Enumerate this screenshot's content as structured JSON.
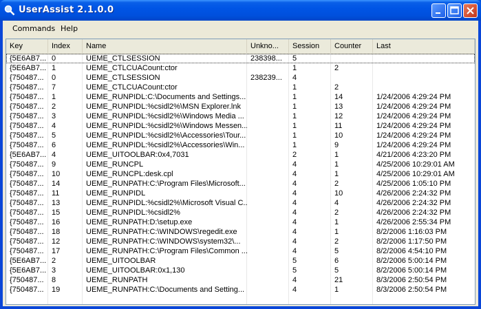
{
  "window": {
    "title": "UserAssist 2.1.0.0"
  },
  "menu": {
    "commands": "Commands",
    "help": "Help"
  },
  "columns": [
    "Key",
    "Index",
    "Name",
    "Unkno...",
    "Session",
    "Counter",
    "Last"
  ],
  "rows": [
    [
      "{5E6AB7...",
      "0",
      "UEME_CTLSESSION",
      "238398...",
      "5",
      "",
      ""
    ],
    [
      "{5E6AB7...",
      "1",
      "UEME_CTLCUACount:ctor",
      "",
      "1",
      "2",
      ""
    ],
    [
      "{750487...",
      "0",
      "UEME_CTLSESSION",
      "238239...",
      "4",
      "",
      ""
    ],
    [
      "{750487...",
      "7",
      "UEME_CTLCUACount:ctor",
      "",
      "1",
      "2",
      ""
    ],
    [
      "{750487...",
      "1",
      "UEME_RUNPIDL:C:\\Documents and Settings...",
      "",
      "1",
      "14",
      "1/24/2006 4:29:24 PM"
    ],
    [
      "{750487...",
      "2",
      "UEME_RUNPIDL:%csidl2%\\MSN Explorer.lnk",
      "",
      "1",
      "13",
      "1/24/2006 4:29:24 PM"
    ],
    [
      "{750487...",
      "3",
      "UEME_RUNPIDL:%csidl2%\\Windows Media ...",
      "",
      "1",
      "12",
      "1/24/2006 4:29:24 PM"
    ],
    [
      "{750487...",
      "4",
      "UEME_RUNPIDL:%csidl2%\\Windows Messen...",
      "",
      "1",
      "11",
      "1/24/2006 4:29:24 PM"
    ],
    [
      "{750487...",
      "5",
      "UEME_RUNPIDL:%csidl2%\\Accessories\\Tour...",
      "",
      "1",
      "10",
      "1/24/2006 4:29:24 PM"
    ],
    [
      "{750487...",
      "6",
      "UEME_RUNPIDL:%csidl2%\\Accessories\\Win...",
      "",
      "1",
      "9",
      "1/24/2006 4:29:24 PM"
    ],
    [
      "{5E6AB7...",
      "4",
      "UEME_UITOOLBAR:0x4,7031",
      "",
      "2",
      "1",
      "4/21/2006 4:23:20 PM"
    ],
    [
      "{750487...",
      "9",
      "UEME_RUNCPL",
      "",
      "4",
      "1",
      "4/25/2006 10:29:01 AM"
    ],
    [
      "{750487...",
      "10",
      "UEME_RUNCPL:desk.cpl",
      "",
      "4",
      "1",
      "4/25/2006 10:29:01 AM"
    ],
    [
      "{750487...",
      "14",
      "UEME_RUNPATH:C:\\Program Files\\Microsoft...",
      "",
      "4",
      "2",
      "4/25/2006 1:05:10 PM"
    ],
    [
      "{750487...",
      "11",
      "UEME_RUNPIDL",
      "",
      "4",
      "10",
      "4/26/2006 2:24:32 PM"
    ],
    [
      "{750487...",
      "13",
      "UEME_RUNPIDL:%csidl2%\\Microsoft Visual C...",
      "",
      "4",
      "4",
      "4/26/2006 2:24:32 PM"
    ],
    [
      "{750487...",
      "15",
      "UEME_RUNPIDL:%csidl2%",
      "",
      "4",
      "2",
      "4/26/2006 2:24:32 PM"
    ],
    [
      "{750487...",
      "16",
      "UEME_RUNPATH:D:\\setup.exe",
      "",
      "4",
      "1",
      "4/26/2006 2:55:34 PM"
    ],
    [
      "{750487...",
      "18",
      "UEME_RUNPATH:C:\\WINDOWS\\regedit.exe",
      "",
      "4",
      "1",
      "8/2/2006 1:16:03 PM"
    ],
    [
      "{750487...",
      "12",
      "UEME_RUNPATH:C:\\WINDOWS\\system32\\...",
      "",
      "4",
      "2",
      "8/2/2006 1:17:50 PM"
    ],
    [
      "{750487...",
      "17",
      "UEME_RUNPATH:C:\\Program Files\\Common ...",
      "",
      "4",
      "5",
      "8/2/2006 4:54:10 PM"
    ],
    [
      "{5E6AB7...",
      "2",
      "UEME_UITOOLBAR",
      "",
      "5",
      "6",
      "8/2/2006 5:00:14 PM"
    ],
    [
      "{5E6AB7...",
      "3",
      "UEME_UITOOLBAR:0x1,130",
      "",
      "5",
      "5",
      "8/2/2006 5:00:14 PM"
    ],
    [
      "{750487...",
      "8",
      "UEME_RUNPATH",
      "",
      "4",
      "21",
      "8/3/2006 2:50:54 PM"
    ],
    [
      "{750487...",
      "19",
      "UEME_RUNPATH:C:\\Documents and Setting...",
      "",
      "4",
      "1",
      "8/3/2006 2:50:54 PM"
    ]
  ]
}
